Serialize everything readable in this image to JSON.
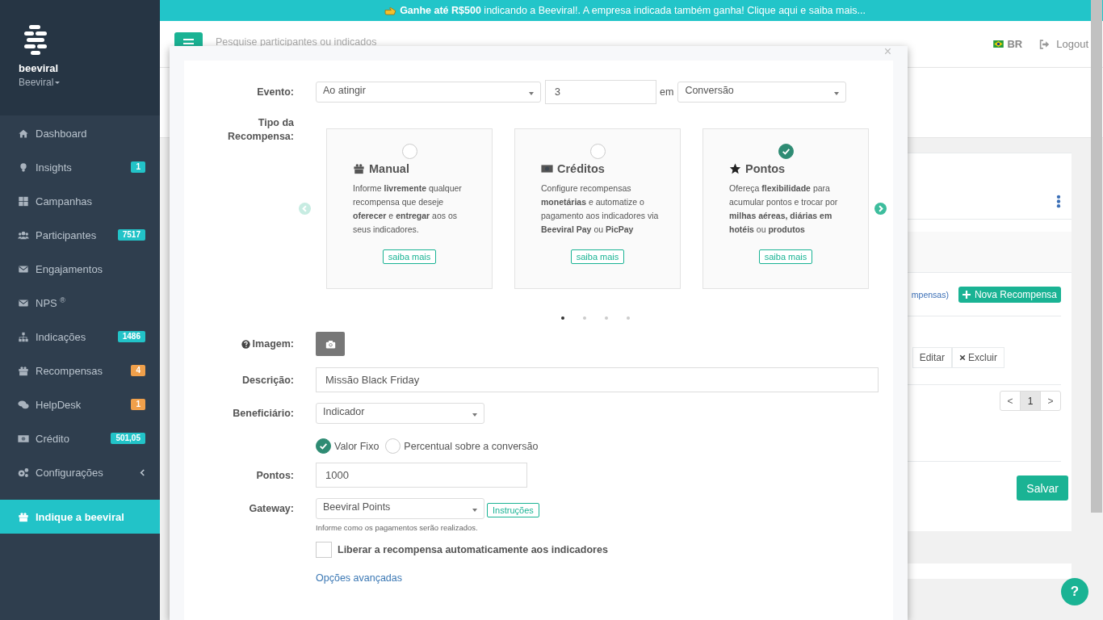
{
  "banner": {
    "text": "**Ganhe até R$500** indicando a Beeviral!. A empresa indicada também ganha! Clique aqui e saiba mais..."
  },
  "sidebar": {
    "brand": "beeviral",
    "account": "Beeviral",
    "items": [
      {
        "label": "Dashboard",
        "kind": "link",
        "selected": false
      },
      {
        "label": "Insights",
        "kind": "link",
        "badge": "1",
        "color": "#22c3c8",
        "selected": false
      },
      {
        "label": "Campanhas",
        "kind": "link",
        "selected": false
      },
      {
        "label": "Participantes",
        "kind": "link",
        "badge": "7517",
        "color": "#22c3c8",
        "selected": false
      },
      {
        "label": "Engajamentos",
        "kind": "link",
        "selected": false
      },
      {
        "label": "NPS $^{®}$",
        "kind": "link",
        "selected": false
      },
      {
        "label": "Indicações",
        "kind": "link",
        "badge": "1486",
        "color": "#22c3c8",
        "selected": false
      },
      {
        "label": "Recompensas",
        "kind": "link",
        "badge": "4",
        "color": "#f0a04b",
        "selected": false
      },
      {
        "label": "HelpDesk",
        "kind": "link",
        "badge": "1",
        "color": "#f0a04b",
        "selected": false
      },
      {
        "label": "Crédito",
        "kind": "link",
        "badge": "501,05",
        "color": "#22c3c8",
        "selected": false
      },
      {
        "label": "Configurações",
        "kind": "submenu",
        "selected": false
      },
      {
        "label": "Indique a beeviral",
        "kind": "link",
        "selected": true
      }
    ]
  },
  "header": {
    "search": {
      "placeholder": "Pesquise participantes ou indicados"
    },
    "language": "BR",
    "logout": "Logout"
  },
  "page": {
    "link_fragment": "mpensas)",
    "new_button": "Nova Recompensa",
    "edit_button": "Editar",
    "delete_button": "Excluir",
    "pages": [
      {
        "label": "<",
        "selected": false
      },
      {
        "label": "1",
        "selected": true
      },
      {
        "label": ">",
        "selected": false
      }
    ],
    "save_button": "Salvar",
    "help_button": "?"
  },
  "modal": {
    "close": "×",
    "event": {
      "label": "Evento:",
      "trigger": "Ao atingir",
      "count": "3",
      "connector": "em",
      "metric": "Conversão"
    },
    "reward_type": {
      "label": "Tipo da Recompensa:",
      "cards": [
        {
          "title": "Manual",
          "description": "Informe **livremente** qualquer recompensa que deseje **oferecer** e **entregar** aos os seus indicadores.",
          "button": "saiba mais",
          "selected": false
        },
        {
          "title": "Créditos",
          "description": "Configure recompensas **monetárias** e automatize o pagamento aos indicadores via **Beeviral Pay** ou **PicPay**",
          "button": "saiba mais",
          "selected": false
        },
        {
          "title": "Pontos",
          "description": "Ofereça **flexibilidade** para acumular pontos e trocar por **milhas aéreas, diárias em hotéis** ou **produtos**",
          "button": "saiba mais",
          "selected": true
        }
      ],
      "dots": [
        {
          "selected": true
        },
        {
          "selected": false
        },
        {
          "selected": false
        },
        {
          "selected": false
        }
      ]
    },
    "image": {
      "label": "Imagem:"
    },
    "description": {
      "label": "Descrição:",
      "value": "Missão Black Friday"
    },
    "beneficiary": {
      "label": "Beneficiário:",
      "value": "Indicador"
    },
    "value_type": [
      {
        "label": "Valor Fixo",
        "selected": true
      },
      {
        "label": "Percentual sobre a conversão",
        "selected": false
      }
    ],
    "points": {
      "label": "Pontos:",
      "value": "1000"
    },
    "gateway": {
      "label": "Gateway:",
      "value": "Beeviral Points",
      "button": "Instruções",
      "help": "Informe como os pagamentos serão realizados."
    },
    "auto_release": {
      "label": "Liberar a recompensa automaticamente aos indicadores",
      "checked": false
    },
    "advanced_link": "Opções avançadas"
  }
}
